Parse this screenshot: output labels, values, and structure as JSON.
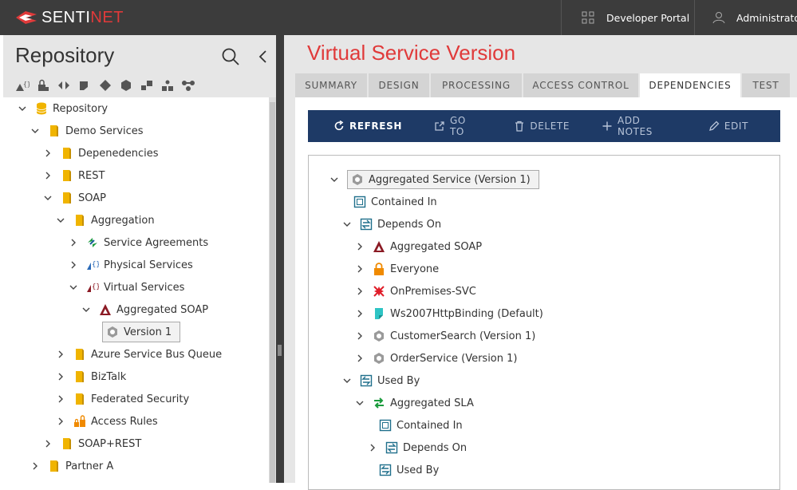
{
  "header": {
    "brand": "SENTINET",
    "developer_portal": "Developer Portal",
    "user": "Administrator"
  },
  "sidebar": {
    "title": "Repository",
    "tree": [
      {
        "label": "Repository",
        "icon": "database-icon"
      },
      {
        "label": "Demo Services",
        "icon": "folder-icon"
      },
      {
        "label": "Depenedencies",
        "icon": "folder-icon"
      },
      {
        "label": "REST",
        "icon": "folder-icon"
      },
      {
        "label": "SOAP",
        "icon": "folder-icon"
      },
      {
        "label": "Aggregation",
        "icon": "folder-icon"
      },
      {
        "label": "Service Agreements",
        "icon": "service-agreements-icon"
      },
      {
        "label": "Physical Services",
        "icon": "physical-services-icon"
      },
      {
        "label": "Virtual Services",
        "icon": "virtual-services-icon"
      },
      {
        "label": "Aggregated SOAP",
        "icon": "virtual-service-icon"
      },
      {
        "label": "Version 1",
        "icon": "version-gear-icon"
      },
      {
        "label": "Azure Service Bus Queue",
        "icon": "folder-icon"
      },
      {
        "label": "BizTalk",
        "icon": "folder-icon"
      },
      {
        "label": "Federated Security",
        "icon": "folder-icon"
      },
      {
        "label": "Access Rules",
        "icon": "access-rules-icon"
      },
      {
        "label": "SOAP+REST",
        "icon": "folder-icon"
      },
      {
        "label": "Partner A",
        "icon": "folder-icon"
      }
    ]
  },
  "main": {
    "title": "Virtual Service Version",
    "tabs": [
      "SUMMARY",
      "DESIGN",
      "PROCESSING",
      "ACCESS CONTROL",
      "DEPENDENCIES",
      "TEST"
    ],
    "active_tab": "DEPENDENCIES",
    "actions": [
      "REFRESH",
      "GO TO",
      "DELETE",
      "ADD NOTES",
      "EDIT"
    ],
    "dependencies": [
      {
        "label": "Aggregated Service (Version 1)",
        "icon": "version-gear-icon"
      },
      {
        "label": "Contained In",
        "icon": "contained-in-icon"
      },
      {
        "label": "Depends On",
        "icon": "depends-on-icon"
      },
      {
        "label": "Aggregated SOAP",
        "icon": "virtual-service-icon"
      },
      {
        "label": "Everyone",
        "icon": "lock-icon"
      },
      {
        "label": "OnPremises-SVC",
        "icon": "node-icon"
      },
      {
        "label": "Ws2007HttpBinding (Default)",
        "icon": "binding-icon"
      },
      {
        "label": "CustomerSearch (Version 1)",
        "icon": "version-gear-icon"
      },
      {
        "label": "OrderService (Version 1)",
        "icon": "version-gear-icon"
      },
      {
        "label": "Used By",
        "icon": "used-by-icon"
      },
      {
        "label": "Aggregated SLA",
        "icon": "agreement-icon"
      },
      {
        "label": "Contained In",
        "icon": "contained-in-icon"
      },
      {
        "label": "Depends On",
        "icon": "depends-on-icon"
      },
      {
        "label": "Used By",
        "icon": "used-by-icon"
      }
    ]
  },
  "colors": {
    "accent": "#e03a3a",
    "actionbar": "#1e3a66",
    "folder": "#f0b400",
    "topbar": "#3c3c3c"
  }
}
